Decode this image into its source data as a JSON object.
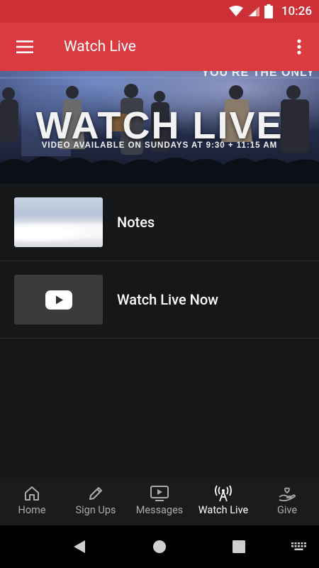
{
  "status_bar": {
    "time": "10:26"
  },
  "app_bar": {
    "title": "Watch Live",
    "menu_icon": "hamburger-menu-icon",
    "more_icon": "more-vert-icon"
  },
  "hero": {
    "tagline_top": "YOU'RE THE ONLY",
    "headline": "WATCH LIVE",
    "subline": "VIDEO AVAILABLE ON SUNDAYS AT 9:30 + 11:15 AM"
  },
  "list": {
    "items": [
      {
        "label": "Notes",
        "thumb": "clouds-image"
      },
      {
        "label": "Watch Live Now",
        "thumb": "youtube-play-icon"
      }
    ]
  },
  "bottom_nav": {
    "items": [
      {
        "label": "Home",
        "icon": "home-icon"
      },
      {
        "label": "Sign Ups",
        "icon": "pencil-icon"
      },
      {
        "label": "Messages",
        "icon": "tv-play-icon"
      },
      {
        "label": "Watch Live",
        "icon": "broadcast-tower-icon",
        "active": true
      },
      {
        "label": "Give",
        "icon": "hand-heart-icon"
      }
    ]
  },
  "colors": {
    "status_bar": "#cc2f35",
    "app_bar": "#db3a41",
    "background": "#161718",
    "nav_bg": "#1a1b1c"
  }
}
